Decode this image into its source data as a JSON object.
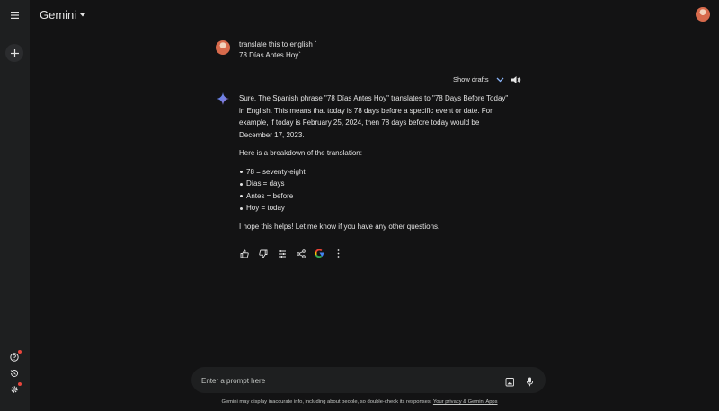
{
  "header": {
    "title": "Gemini"
  },
  "rail": {
    "menu_icon": "hamburger-icon",
    "new_chat_icon": "plus-icon",
    "help_icon": "help-icon",
    "activity_icon": "history-icon",
    "settings_icon": "gear-icon"
  },
  "user_message": {
    "line1": "translate this to english `",
    "line2": "78 Días Antes Hoy`"
  },
  "drafts": {
    "label": "Show drafts"
  },
  "response": {
    "para1": "Sure. The Spanish phrase \"78 Días Antes Hoy\" translates to \"78 Days Before Today\" in English. This means that today is 78 days before a specific event or date. For example, if today is February 25, 2024, then 78 days before today would be December 17, 2023.",
    "para2": "Here is a breakdown of the translation:",
    "bullets": [
      "78 = seventy-eight",
      "Días = days",
      "Antes = before",
      "Hoy = today"
    ],
    "para3": "I hope this helps! Let me know if you have any other questions."
  },
  "prompt": {
    "placeholder": "Enter a prompt here"
  },
  "footer": {
    "disclaimer": "Gemini may display inaccurate info, including about people, so double-check its responses.",
    "link": "Your privacy & Gemini Apps"
  },
  "colors": {
    "background": "#131314",
    "rail": "#1e1f20",
    "accent_blue": "#8ab4f8",
    "notification_red": "#e8453c"
  }
}
